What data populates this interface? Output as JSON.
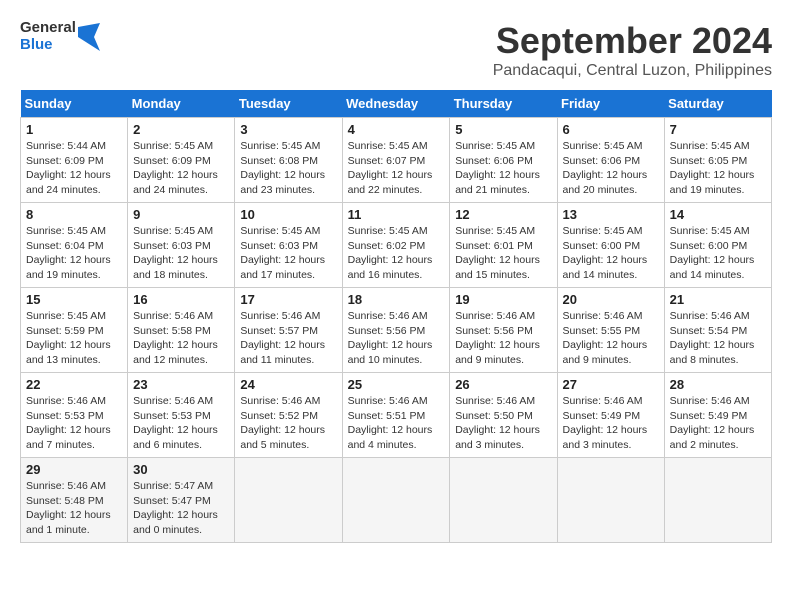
{
  "header": {
    "logo_line1": "General",
    "logo_line2": "Blue",
    "month": "September 2024",
    "location": "Pandacaqui, Central Luzon, Philippines"
  },
  "weekdays": [
    "Sunday",
    "Monday",
    "Tuesday",
    "Wednesday",
    "Thursday",
    "Friday",
    "Saturday"
  ],
  "weeks": [
    [
      {
        "day": "1",
        "sunrise": "5:44 AM",
        "sunset": "6:09 PM",
        "daylight": "12 hours and 24 minutes."
      },
      {
        "day": "2",
        "sunrise": "5:45 AM",
        "sunset": "6:09 PM",
        "daylight": "12 hours and 24 minutes."
      },
      {
        "day": "3",
        "sunrise": "5:45 AM",
        "sunset": "6:08 PM",
        "daylight": "12 hours and 23 minutes."
      },
      {
        "day": "4",
        "sunrise": "5:45 AM",
        "sunset": "6:07 PM",
        "daylight": "12 hours and 22 minutes."
      },
      {
        "day": "5",
        "sunrise": "5:45 AM",
        "sunset": "6:06 PM",
        "daylight": "12 hours and 21 minutes."
      },
      {
        "day": "6",
        "sunrise": "5:45 AM",
        "sunset": "6:06 PM",
        "daylight": "12 hours and 20 minutes."
      },
      {
        "day": "7",
        "sunrise": "5:45 AM",
        "sunset": "6:05 PM",
        "daylight": "12 hours and 19 minutes."
      }
    ],
    [
      {
        "day": "8",
        "sunrise": "5:45 AM",
        "sunset": "6:04 PM",
        "daylight": "12 hours and 19 minutes."
      },
      {
        "day": "9",
        "sunrise": "5:45 AM",
        "sunset": "6:03 PM",
        "daylight": "12 hours and 18 minutes."
      },
      {
        "day": "10",
        "sunrise": "5:45 AM",
        "sunset": "6:03 PM",
        "daylight": "12 hours and 17 minutes."
      },
      {
        "day": "11",
        "sunrise": "5:45 AM",
        "sunset": "6:02 PM",
        "daylight": "12 hours and 16 minutes."
      },
      {
        "day": "12",
        "sunrise": "5:45 AM",
        "sunset": "6:01 PM",
        "daylight": "12 hours and 15 minutes."
      },
      {
        "day": "13",
        "sunrise": "5:45 AM",
        "sunset": "6:00 PM",
        "daylight": "12 hours and 14 minutes."
      },
      {
        "day": "14",
        "sunrise": "5:45 AM",
        "sunset": "6:00 PM",
        "daylight": "12 hours and 14 minutes."
      }
    ],
    [
      {
        "day": "15",
        "sunrise": "5:45 AM",
        "sunset": "5:59 PM",
        "daylight": "12 hours and 13 minutes."
      },
      {
        "day": "16",
        "sunrise": "5:46 AM",
        "sunset": "5:58 PM",
        "daylight": "12 hours and 12 minutes."
      },
      {
        "day": "17",
        "sunrise": "5:46 AM",
        "sunset": "5:57 PM",
        "daylight": "12 hours and 11 minutes."
      },
      {
        "day": "18",
        "sunrise": "5:46 AM",
        "sunset": "5:56 PM",
        "daylight": "12 hours and 10 minutes."
      },
      {
        "day": "19",
        "sunrise": "5:46 AM",
        "sunset": "5:56 PM",
        "daylight": "12 hours and 9 minutes."
      },
      {
        "day": "20",
        "sunrise": "5:46 AM",
        "sunset": "5:55 PM",
        "daylight": "12 hours and 9 minutes."
      },
      {
        "day": "21",
        "sunrise": "5:46 AM",
        "sunset": "5:54 PM",
        "daylight": "12 hours and 8 minutes."
      }
    ],
    [
      {
        "day": "22",
        "sunrise": "5:46 AM",
        "sunset": "5:53 PM",
        "daylight": "12 hours and 7 minutes."
      },
      {
        "day": "23",
        "sunrise": "5:46 AM",
        "sunset": "5:53 PM",
        "daylight": "12 hours and 6 minutes."
      },
      {
        "day": "24",
        "sunrise": "5:46 AM",
        "sunset": "5:52 PM",
        "daylight": "12 hours and 5 minutes."
      },
      {
        "day": "25",
        "sunrise": "5:46 AM",
        "sunset": "5:51 PM",
        "daylight": "12 hours and 4 minutes."
      },
      {
        "day": "26",
        "sunrise": "5:46 AM",
        "sunset": "5:50 PM",
        "daylight": "12 hours and 3 minutes."
      },
      {
        "day": "27",
        "sunrise": "5:46 AM",
        "sunset": "5:49 PM",
        "daylight": "12 hours and 3 minutes."
      },
      {
        "day": "28",
        "sunrise": "5:46 AM",
        "sunset": "5:49 PM",
        "daylight": "12 hours and 2 minutes."
      }
    ],
    [
      {
        "day": "29",
        "sunrise": "5:46 AM",
        "sunset": "5:48 PM",
        "daylight": "12 hours and 1 minute."
      },
      {
        "day": "30",
        "sunrise": "5:47 AM",
        "sunset": "5:47 PM",
        "daylight": "12 hours and 0 minutes."
      },
      null,
      null,
      null,
      null,
      null
    ]
  ]
}
